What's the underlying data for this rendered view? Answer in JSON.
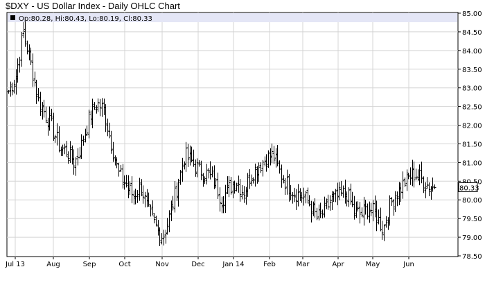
{
  "chart_title": "$DXY - US Dollar Index - Daily OHLC Chart",
  "colors": {
    "background": "#ffffff",
    "grid": "#d4d4d4",
    "info_band": "#e4e6f6",
    "bars": "#000000",
    "last_price_box": "#ffffff"
  },
  "chart_data": {
    "type": "ohlc",
    "title": "$DXY - US Dollar Index - Daily OHLC Chart",
    "legend_text": "Op:80.28, Hi:80.43, Lo:80.19, Cl:80.33",
    "last_price_label": "80.33",
    "ylim": [
      78.5,
      85.0
    ],
    "y_ticks": [
      "85.00",
      "84.50",
      "84.00",
      "83.50",
      "83.00",
      "82.50",
      "82.00",
      "81.50",
      "81.00",
      "80.50",
      "80.00",
      "79.50",
      "79.00",
      "78.50"
    ],
    "x_ticks": [
      "Jul 13",
      "Aug",
      "Sep",
      "Oct",
      "Nov",
      "Dec",
      "Jan 14",
      "Feb",
      "Mar",
      "Apr",
      "May",
      "Jun"
    ],
    "grid": true,
    "trend_closes": [
      [
        "Jul 13",
        82.9
      ],
      [
        "Jul 13",
        83.3
      ],
      [
        "Jul 13",
        84.5
      ],
      [
        "Jul 13",
        83.7
      ],
      [
        "Jul 13",
        82.7
      ],
      [
        "Jul 13",
        82.3
      ],
      [
        "Aug",
        81.9
      ],
      [
        "Aug",
        81.4
      ],
      [
        "Aug",
        81.3
      ],
      [
        "Aug",
        81.0
      ],
      [
        "Aug",
        81.5
      ],
      [
        "Aug",
        82.2
      ],
      [
        "Aug",
        82.6
      ],
      [
        "Sep",
        82.4
      ],
      [
        "Sep",
        81.5
      ],
      [
        "Sep",
        80.7
      ],
      [
        "Sep",
        80.4
      ],
      [
        "Sep",
        80.1
      ],
      [
        "Oct",
        80.4
      ],
      [
        "Oct",
        79.7
      ],
      [
        "Oct",
        79.3
      ],
      [
        "Oct",
        79.0
      ],
      [
        "Oct",
        79.6
      ],
      [
        "Oct",
        80.4
      ],
      [
        "Nov",
        81.2
      ],
      [
        "Nov",
        81.0
      ],
      [
        "Nov",
        80.8
      ],
      [
        "Nov",
        80.7
      ],
      [
        "Dec",
        80.5
      ],
      [
        "Dec",
        80.0
      ],
      [
        "Dec",
        80.3
      ],
      [
        "Dec",
        80.5
      ],
      [
        "Dec",
        80.2
      ],
      [
        "Jan 14",
        80.7
      ],
      [
        "Jan 14",
        80.9
      ],
      [
        "Jan 14",
        81.1
      ],
      [
        "Jan 14",
        81.2
      ],
      [
        "Feb",
        80.7
      ],
      [
        "Feb",
        80.4
      ],
      [
        "Feb",
        80.2
      ],
      [
        "Feb",
        80.1
      ],
      [
        "Mar",
        79.9
      ],
      [
        "Mar",
        79.5
      ],
      [
        "Mar",
        79.7
      ],
      [
        "Mar",
        80.0
      ],
      [
        "Mar",
        80.1
      ],
      [
        "Apr",
        80.2
      ],
      [
        "Apr",
        79.7
      ],
      [
        "Apr",
        79.6
      ],
      [
        "Apr",
        79.8
      ],
      [
        "May",
        79.6
      ],
      [
        "May",
        79.2
      ],
      [
        "May",
        79.9
      ],
      [
        "May",
        80.2
      ],
      [
        "Jun",
        80.5
      ],
      [
        "Jun",
        80.7
      ],
      [
        "Jun",
        80.6
      ],
      [
        "Jun",
        80.4
      ],
      [
        "Jun",
        80.33
      ]
    ]
  }
}
